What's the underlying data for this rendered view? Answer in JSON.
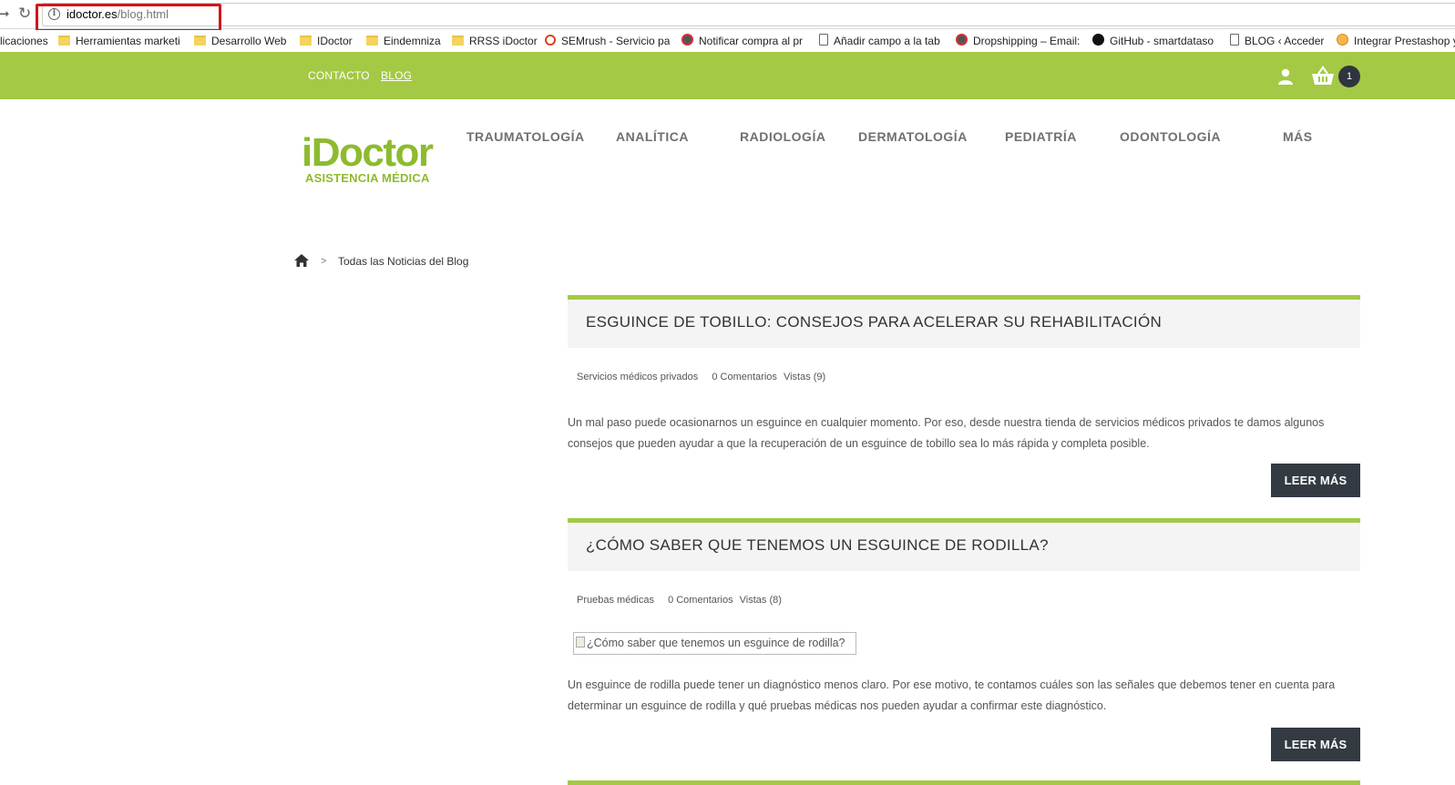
{
  "browser": {
    "url_host": "idoctor.es",
    "url_path": "/blog.html",
    "bookmarks": [
      {
        "label": "licaciones",
        "icon": "none"
      },
      {
        "label": "Herramientas marketi",
        "icon": "folder-icon"
      },
      {
        "label": "Desarrollo Web",
        "icon": "folder-icon"
      },
      {
        "label": "IDoctor",
        "icon": "folder-icon"
      },
      {
        "label": "Eindemniza",
        "icon": "folder-icon"
      },
      {
        "label": "RRSS iDoctor",
        "icon": "folder-icon"
      },
      {
        "label": "SEMrush - Servicio pa",
        "icon": "semrush-icon"
      },
      {
        "label": "Notificar compra al pr",
        "icon": "bird-icon"
      },
      {
        "label": "Añadir campo a la tab",
        "icon": "page-icon"
      },
      {
        "label": "Dropshipping – Email:",
        "icon": "bird-icon"
      },
      {
        "label": "GitHub - smartdataso",
        "icon": "github-icon"
      },
      {
        "label": "BLOG ‹ Acceder",
        "icon": "page-icon"
      },
      {
        "label": "Integrar Prestashop y",
        "icon": "prestashop-icon"
      }
    ]
  },
  "topbar": {
    "contact": "CONTACTO",
    "blog": "BLOG",
    "cart_count": "1",
    "color": "#a4c944"
  },
  "logo": {
    "main": "iDoctor",
    "sub": "ASISTENCIA MÉDICA"
  },
  "menu": [
    {
      "label": "TRAUMATOLOGÍA"
    },
    {
      "label": "ANALÍTICA"
    },
    {
      "label": "RADIOLOGÍA"
    },
    {
      "label": "DERMATOLOGÍA"
    },
    {
      "label": "PEDIATRÍA"
    },
    {
      "label": "ODONTOLOGÍA"
    },
    {
      "label": "MÁS"
    }
  ],
  "breadcrumb": {
    "separator": ">",
    "current": "Todas las Noticias del Blog"
  },
  "posts": [
    {
      "title": "ESGUINCE DE TOBILLO: CONSEJOS PARA ACELERAR SU REHABILITACIÓN",
      "category": "Servicios médicos privados",
      "comments": "0 Comentarios",
      "views": "Vistas (9)",
      "excerpt": "Un mal paso puede ocasionarnos un esguince en cualquier momento. Por eso, desde nuestra tienda de servicios médicos privados te damos algunos consejos que pueden ayudar a que la recuperación de un esguince de tobillo sea lo más rápida y completa posible.",
      "read_more": "LEER MÁS"
    },
    {
      "title": "¿CÓMO SABER QUE TENEMOS UN ESGUINCE DE RODILLA?",
      "category": "Pruebas médicas",
      "comments": "0 Comentarios",
      "views": "Vistas (8)",
      "image_alt": "¿Cómo saber que tenemos un esguince de rodilla?",
      "excerpt": "Un esguince de rodilla puede tener un diagnóstico menos claro. Por ese motivo, te contamos cuáles son las señales que debemos tener en cuenta para determinar un esguince de rodilla y qué pruebas médicas nos pueden ayudar a confirmar este diagnóstico.",
      "read_more": "LEER MÁS"
    }
  ]
}
